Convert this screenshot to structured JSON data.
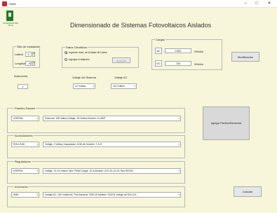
{
  "window": {
    "title": "Sistfv"
  },
  "window_controls": {
    "minimize": "–",
    "maximize": "□",
    "close": "✕"
  },
  "logo": {
    "text": "UNIVERSIDAD DEL VALLE"
  },
  "main_title": "Dimensionado de Sistemas Fotovoltaicos Aislados",
  "location": {
    "title": "Sitio de instalación",
    "latitude_label": "Latitud",
    "latitude_value": "4",
    "longitude_label": "Longitud",
    "longitude_value": "-75"
  },
  "data_input": {
    "title": "Datos Climáticos",
    "option_database": "Ingresar Irrad. de la Base de Datos",
    "option_manual": "Agregar Irradiación",
    "add_button": "Agregar"
  },
  "loads": {
    "title": "Cargas",
    "ac_label": "AC",
    "ac_value": "1000",
    "ac_unit": "Wh/día",
    "dc_label": "DC",
    "dc_value": "700",
    "dc_unit": "Wh/día"
  },
  "edit_loads_button": "Modificación",
  "autonomy": {
    "label": "Autonomía",
    "value": "1"
  },
  "system_voltage": {
    "label": "Voltaje del Sistema",
    "selected": "12 Voltios"
  },
  "ac_voltage": {
    "label": "Voltaje AC",
    "selected": "110 Voltios"
  },
  "solar_panels": {
    "label": "Paneles Solares",
    "model": "ATERSA",
    "spec": "Potencia: 150 Vatios    Voltaje: 18 Voltios    Modelo: A-150P"
  },
  "batteries": {
    "label": "Acumuladores",
    "model": "ROLLS/4K",
    "spec": "Voltaje: 2 Voltios    Capacidad: 4136 Ah    Modelo: T-5-S"
  },
  "regulators": {
    "label": "Reguladores",
    "model": "ATERSA",
    "spec": "Voltaje: 12-24 Voltios    Tipo: PWM    Carga: 10 A    Modelo: LEO 20-12-24 Tipo REGM"
  },
  "inverters": {
    "label": "Inversores",
    "model": "SMA",
    "spec": "Voltaje AC: 230 Voltios AC    Pot.Nominal: 2000 W    Modelo: SI2224 Voltaje de Ent.12V..."
  },
  "add_panels_button": "Agregar Paneles/Elementos",
  "calculate_button": "Calcular"
}
